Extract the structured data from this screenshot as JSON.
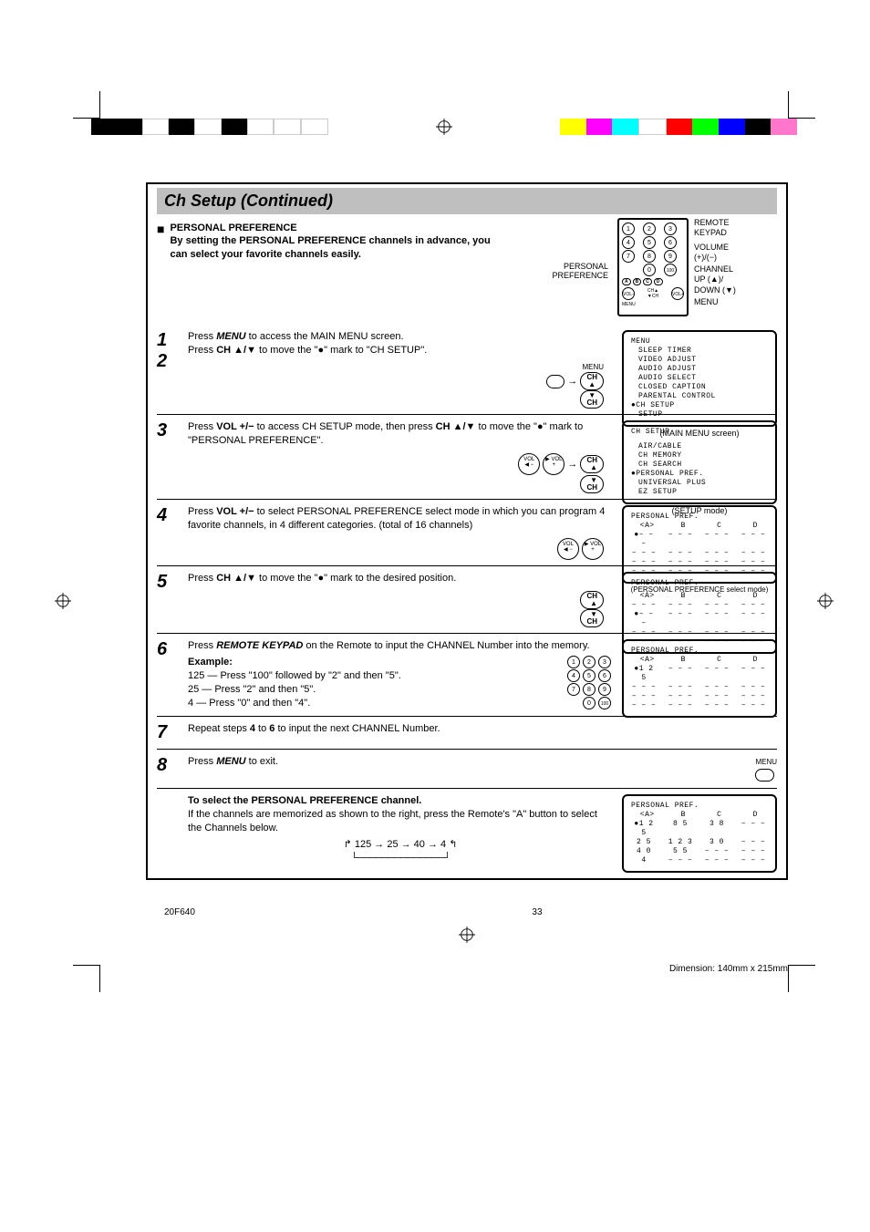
{
  "page": {
    "title": "Ch Setup (Continued)",
    "section_heading": "PERSONAL PREFERENCE",
    "section_sub": "By setting the PERSONAL PREFERENCE channels in advance, you can select your favorite channels easily.",
    "pref_label_top": "PERSONAL",
    "pref_label_bottom": "PREFERENCE",
    "model": "20F640",
    "page_num": "33",
    "dimension": "Dimension: 140mm x 215mm"
  },
  "remote": {
    "l1": "REMOTE",
    "l2": "KEYPAD",
    "l3": "VOLUME",
    "l4": "(+)/(−)",
    "l5": "CHANNEL",
    "l6": "UP (▲)/",
    "l7": "DOWN (▼)",
    "l8": "MENU"
  },
  "steps": {
    "s1": {
      "num": "1",
      "text_a": "Press ",
      "btn": "MENU",
      "text_b": " to access the MAIN MENU screen."
    },
    "s2": {
      "num": "2",
      "text_a": "Press ",
      "btn": "CH ▲/▼",
      "text_b": " to move the \"●\" mark to \"CH SETUP\".",
      "icon_menu": "MENU",
      "icon_ch_up": "CH\n▲",
      "icon_ch_dn": "▼\nCH",
      "screen_title": "MENU",
      "screen_lines": [
        "SLEEP TIMER",
        "VIDEO ADJUST",
        "AUDIO ADJUST",
        "AUDIO SELECT",
        "CLOSED CAPTION",
        "PARENTAL CONTROL",
        "●CH SETUP",
        "SETUP"
      ],
      "caption": "(MAIN MENU screen)"
    },
    "s3": {
      "num": "3",
      "text_a": "Press ",
      "btn": "VOL +/−",
      "text_b": " to access CH SETUP mode, then press ",
      "btn2": "CH ▲/▼",
      "text_c": " to move the \"●\" mark to \"PERSONAL PREFERENCE\".",
      "screen_title": "CH SETUP",
      "screen_lines": [
        "AIR/CABLE",
        "CH MEMORY",
        "CH SEARCH",
        "●PERSONAL PREF.",
        "UNIVERSAL PLUS",
        "EZ SETUP"
      ],
      "caption": "(SETUP mode)"
    },
    "s4": {
      "num": "4",
      "text_a": "Press ",
      "btn": "VOL +/−",
      "text_b": " to select PERSONAL PREFERENCE select mode in which you can program 4 favorite channels, in 4 different categories. (total of 16 channels)",
      "screen_title": "PERSONAL PREF.",
      "cols": [
        "<A>",
        "B",
        "C",
        "D"
      ],
      "rows": [
        [
          "●– – –",
          "– – –",
          "– – –",
          "– – –"
        ],
        [
          "– – –",
          "– – –",
          "– – –",
          "– – –"
        ],
        [
          "– – –",
          "– – –",
          "– – –",
          "– – –"
        ],
        [
          "– – –",
          "– – –",
          "– – –",
          "– – –"
        ]
      ],
      "caption": "(PERSONAL PREFERENCE select mode)"
    },
    "s5": {
      "num": "5",
      "text_a": "Press ",
      "btn": "CH ▲/▼",
      "text_b": " to move the \"●\" mark to the desired position.",
      "screen_title": "PERSONAL PREF.",
      "cols": [
        "<A>",
        "B",
        "C",
        "D"
      ],
      "rows": [
        [
          "– – –",
          "– – –",
          "– – –",
          "– – –"
        ],
        [
          "●– – –",
          "– – –",
          "– – –",
          "– – –"
        ],
        [
          "– – –",
          "– – –",
          "– – –",
          "– – –"
        ],
        [
          "– – –",
          "– – –",
          "– – –",
          "– – –"
        ]
      ]
    },
    "s6": {
      "num": "6",
      "text_a": "Press ",
      "btn": "REMOTE KEYPAD",
      "text_b": " on the Remote to input the CHANNEL Number into the memory.",
      "example_label": "Example:",
      "ex1": "125 — Press \"100\" followed by \"2\" and then \"5\".",
      "ex2": "25   — Press \"2\" and then \"5\".",
      "ex3": "4     — Press \"0\" and then \"4\".",
      "screen_title": "PERSONAL PREF.",
      "cols": [
        "<A>",
        "B",
        "C",
        "D"
      ],
      "rows": [
        [
          "●1 2 5",
          "– – –",
          "– – –",
          "– – –"
        ],
        [
          "– – –",
          "– – –",
          "– – –",
          "– – –"
        ],
        [
          "– – –",
          "– – –",
          "– – –",
          "– – –"
        ],
        [
          "– – –",
          "– – –",
          "– – –",
          "– – –"
        ]
      ]
    },
    "s7": {
      "num": "7",
      "text_a": "Repeat steps ",
      "b1": "4",
      "mid": " to ",
      "b2": "6",
      "text_b": " to input the next CHANNEL Number."
    },
    "s8": {
      "num": "8",
      "text_a": "Press ",
      "btn": "MENU",
      "text_b": " to exit.",
      "icon_menu": "MENU"
    }
  },
  "select": {
    "heading": "To select the PERSONAL PREFERENCE channel.",
    "line1": "If the channels are memorized as shown to the right, press the Remote's \"A\" button to select the Channels below.",
    "cycle": "125 → 25 → 40 → 4",
    "screen_title": "PERSONAL PREF.",
    "cols": [
      "<A>",
      "B",
      "C",
      "D"
    ],
    "rows": [
      [
        "●1 2 5",
        "8 5",
        "3 8",
        "– – –"
      ],
      [
        "2 5",
        "1 2 3",
        "3 0",
        "– – –"
      ],
      [
        "4 0",
        "5 5",
        "– – –",
        "– – –"
      ],
      [
        "4",
        "– – –",
        "– – –",
        "– – –"
      ]
    ]
  }
}
